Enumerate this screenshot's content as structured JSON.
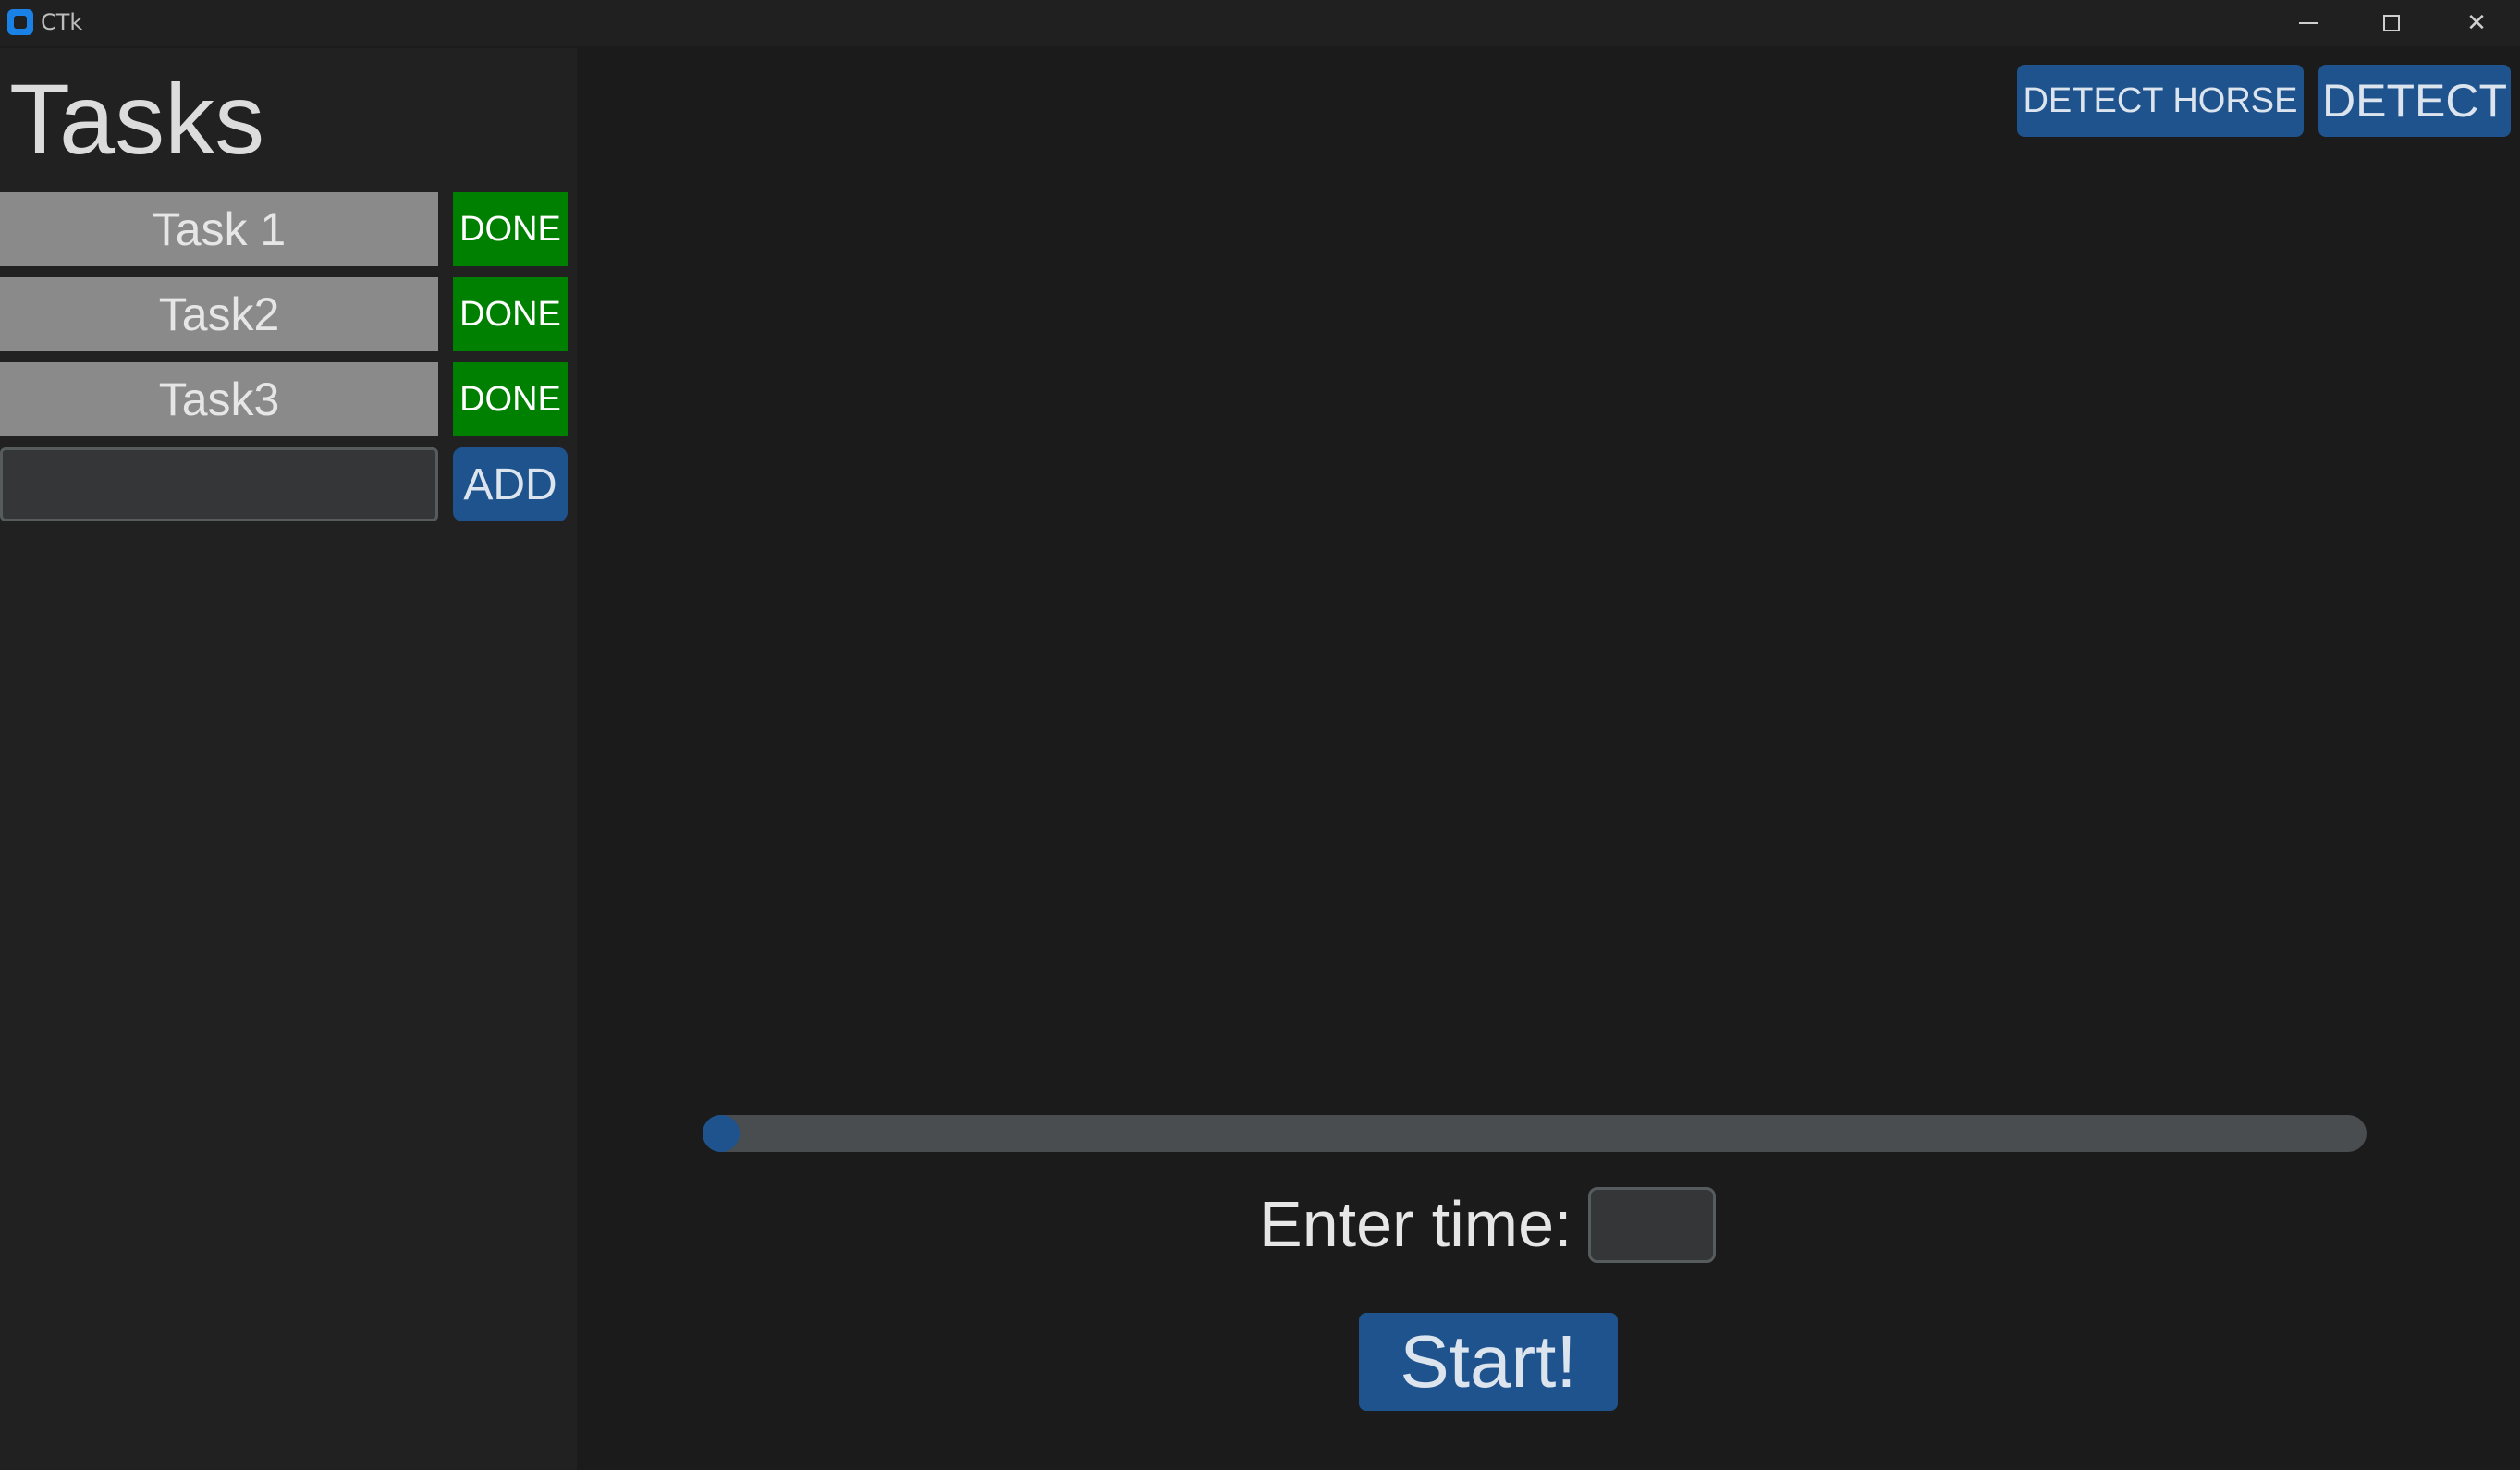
{
  "window": {
    "title": "CTk",
    "controls": {
      "minimize": "minimize-icon",
      "maximize": "maximize-icon",
      "close": "✕"
    }
  },
  "sidebar": {
    "title": "Tasks",
    "tasks": [
      {
        "label": "Task 1",
        "action": "DONE"
      },
      {
        "label": "Task2",
        "action": "DONE"
      },
      {
        "label": "Task3",
        "action": "DONE"
      }
    ],
    "new_task": {
      "value": "",
      "placeholder": "",
      "button": "ADD"
    }
  },
  "toolbar": {
    "detect_horse": "DETECT HORSE",
    "detect": "DETECT"
  },
  "timer": {
    "progress": 0,
    "label": "Enter time:",
    "input_value": "",
    "start": "Start!"
  },
  "colors": {
    "accent": "#1f538d",
    "done": "#008000",
    "background": "#1b1b1b",
    "sidebar": "#212121",
    "task_bg": "#8a8a8a",
    "track": "#4a4d50"
  }
}
